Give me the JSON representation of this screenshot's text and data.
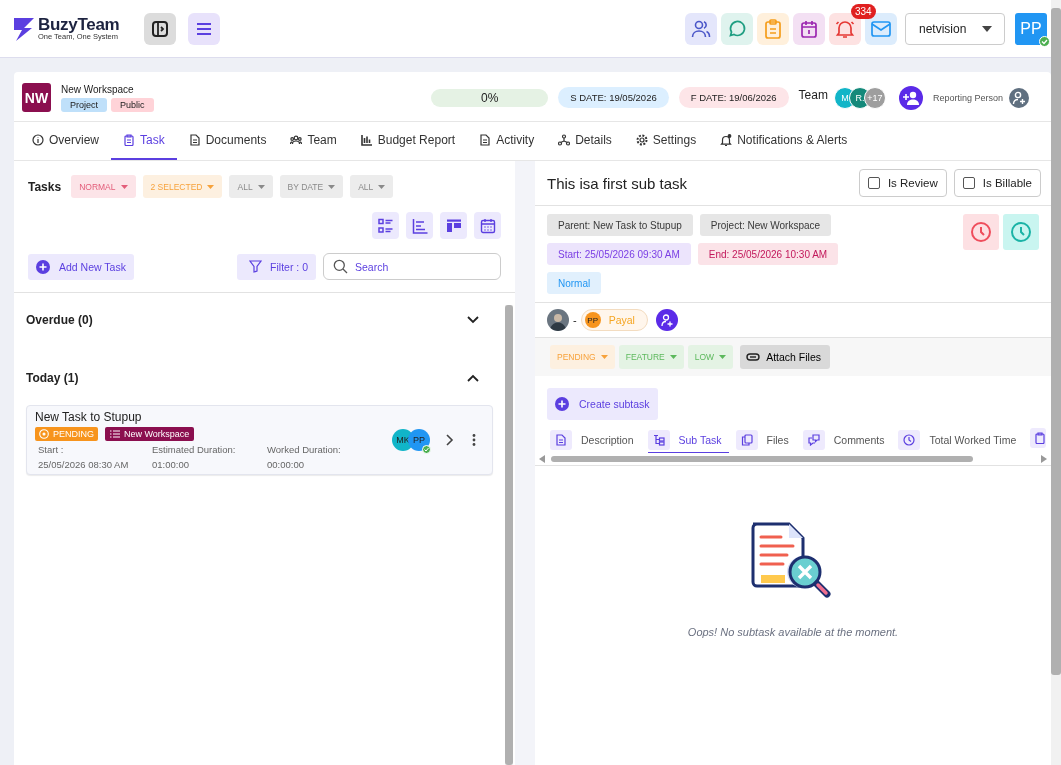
{
  "header": {
    "brand": "BuzyTeam",
    "tagline": "One Team, One System",
    "notification_count": "334",
    "workspace_select": "netvision",
    "user_initials": "PP"
  },
  "workspace": {
    "initials": "NW",
    "name": "New Workspace",
    "tags": [
      {
        "label": "Project",
        "color": "#bfe0fa"
      },
      {
        "label": "Public",
        "color": "#ffd3d8"
      }
    ],
    "progress": {
      "label": "0%",
      "level": 0
    },
    "start_date": "S DATE: 19/05/2026",
    "finish_date": "F DATE: 19/06/2026",
    "team_label": "Team",
    "team_avatars": [
      {
        "initials": "M",
        "color": "#11b5c8"
      },
      {
        "initials": "R.",
        "color": "#14897a"
      },
      {
        "initials": "+17",
        "color": "#9e9e9e"
      }
    ],
    "reporting_label": "Reporting Person"
  },
  "tabs": [
    {
      "label": "Overview",
      "selected": false,
      "kind": "info"
    },
    {
      "label": "Task",
      "selected": true,
      "kind": "clipboard"
    },
    {
      "label": "Documents",
      "selected": false,
      "kind": "doc"
    },
    {
      "label": "Team",
      "selected": false,
      "kind": "people"
    },
    {
      "label": "Budget Report",
      "selected": false,
      "kind": "chart"
    },
    {
      "label": "Activity",
      "selected": false,
      "kind": "doc"
    },
    {
      "label": "Details",
      "selected": false,
      "kind": "tree"
    },
    {
      "label": "Settings",
      "selected": false,
      "kind": "gear"
    },
    {
      "label": "Notifications & Alerts",
      "selected": false,
      "kind": "bell"
    }
  ],
  "tasks_panel": {
    "title": "Tasks",
    "filters": [
      {
        "label": "NORMAL",
        "kind": "pink"
      },
      {
        "label": "2 SELECTED",
        "kind": "orange"
      },
      {
        "label": "ALL",
        "kind": "grey"
      },
      {
        "label": "BY DATE",
        "kind": "grey"
      },
      {
        "label": "ALL",
        "kind": "grey"
      }
    ],
    "add_button": "Add New Task",
    "filter_button": "Filter : 0",
    "search_placeholder": "Search",
    "sections": [
      {
        "title": "Overdue (0)",
        "expanded": false
      },
      {
        "title": "Today (1)",
        "expanded": true,
        "tasks": [
          {
            "title": "New Task to Stupup",
            "status": "PENDING",
            "project": "New Workspace",
            "fields": [
              {
                "label": "Start :",
                "value": "25/05/2026 08:30 AM"
              },
              {
                "label": "Estimated Duration:",
                "value": "01:00:00"
              },
              {
                "label": "Worked Duration:",
                "value": "00:00:00"
              }
            ],
            "assignees": [
              {
                "initials": "MK",
                "color": "#11b5c8"
              },
              {
                "initials": "PP",
                "color": "#2196f3"
              }
            ]
          }
        ]
      }
    ]
  },
  "detail": {
    "title": "This isa first sub task",
    "checks": [
      {
        "label": "Is Review",
        "checked": false
      },
      {
        "label": "Is Billable",
        "checked": false
      }
    ],
    "chips": [
      {
        "label": "Parent:  New Task to Stupup",
        "kind": "grey"
      },
      {
        "label": "Project:  New Workspace",
        "kind": "grey"
      },
      {
        "label": "Start:  25/05/2026 09:30 AM",
        "kind": "purple"
      },
      {
        "label": "End:  25/05/2026 10:30 AM",
        "kind": "red"
      },
      {
        "label": "Normal",
        "kind": "blue"
      }
    ],
    "separator": "-",
    "assignee": {
      "initials": "PP",
      "name": "Payal"
    },
    "dropdowns": [
      {
        "label": "PENDING",
        "kind": "orange"
      },
      {
        "label": "FEATURE",
        "kind": "green"
      },
      {
        "label": "LOW",
        "kind": "green"
      }
    ],
    "attach_button": "Attach Files",
    "create_button": "Create subtask",
    "subtabs": [
      {
        "label": "Description",
        "selected": false,
        "kind": "doc"
      },
      {
        "label": "Sub Task",
        "selected": true,
        "kind": "tree"
      },
      {
        "label": "Files",
        "selected": false,
        "kind": "files"
      },
      {
        "label": "Comments",
        "selected": false,
        "kind": "chat"
      },
      {
        "label": "Total Worked Time",
        "selected": false,
        "kind": "clock"
      }
    ],
    "empty_message": "Oops! No subtask available at the moment."
  }
}
